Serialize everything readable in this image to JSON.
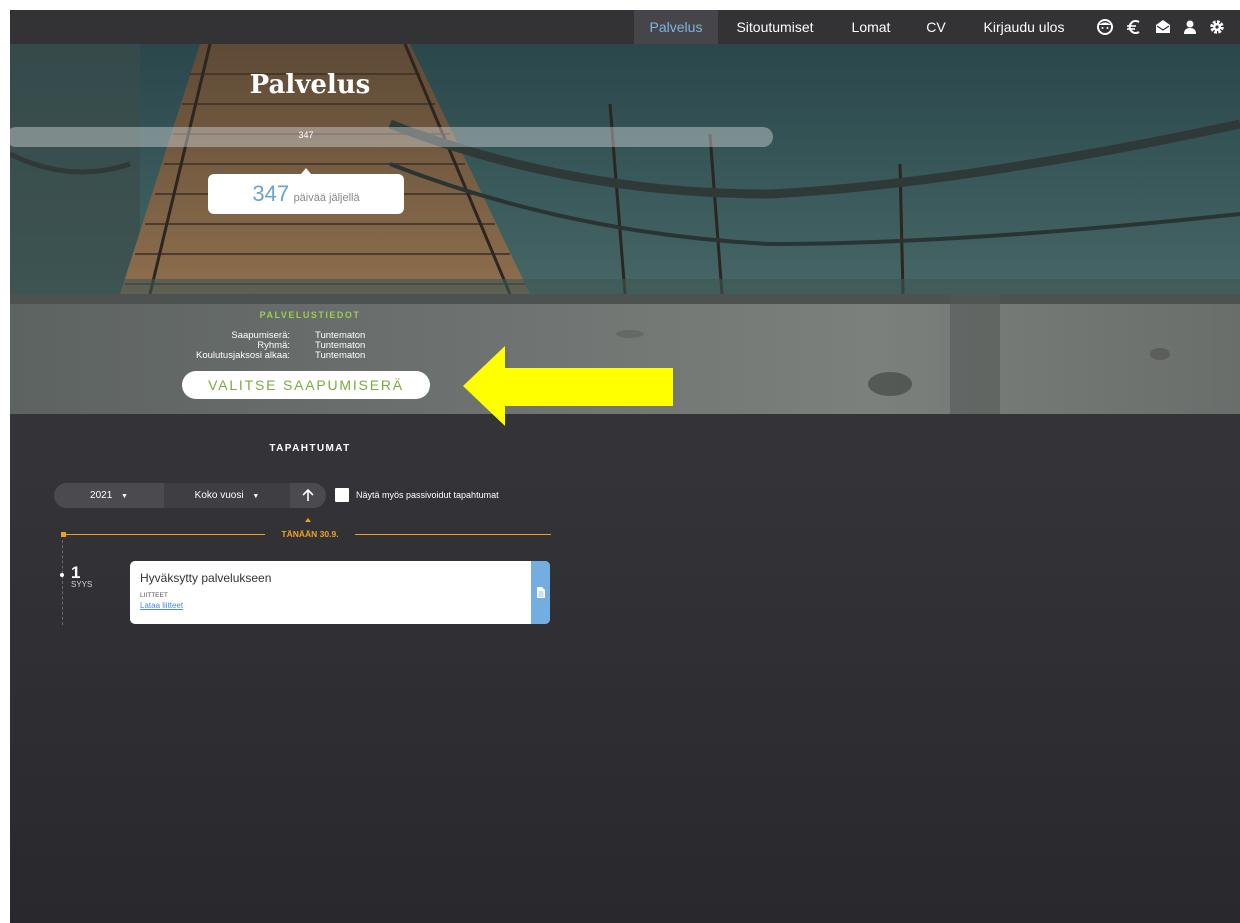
{
  "nav": {
    "items": [
      {
        "label": "Palvelus",
        "active": true
      },
      {
        "label": "Sitoutumiset",
        "active": false
      },
      {
        "label": "Lomat",
        "active": false
      },
      {
        "label": "CV",
        "active": false
      },
      {
        "label": "Kirjaudu ulos",
        "active": false
      }
    ],
    "icons": [
      "face-icon",
      "euro-icon",
      "mail-icon",
      "user-icon",
      "gear-icon"
    ],
    "active_color": "#7fb3dd"
  },
  "hero": {
    "title": "Palvelus",
    "progress_label": "347",
    "progress_fraction": 0.0,
    "days_remaining": "347",
    "days_text": "päivää jäljellä"
  },
  "info": {
    "heading": "PALVELUSTIEDOT",
    "rows": [
      {
        "label": "Saapumiserä:",
        "value": "Tuntematon"
      },
      {
        "label": "Ryhmä:",
        "value": "Tuntematon"
      },
      {
        "label": "Koulutusjaksosi alkaa:",
        "value": "Tuntematon"
      }
    ],
    "button_label": "VALITSE SAAPUMISERÄ",
    "accent_color": "#9dcc4e"
  },
  "events": {
    "heading": "TAPAHTUMAT",
    "year": "2021",
    "period": "Koko vuosi",
    "passive_label": "Näytä myös passivoidut tapahtumat",
    "passive_checked": false,
    "today_label": "TÄNÄÄN 30.9.",
    "today_color": "#f0a020",
    "items": [
      {
        "day": "1",
        "month": "SYYS",
        "title": "Hyväksytty palvelukseen",
        "attachments_label": "LIITTEET",
        "attachments_link": "Lataa liitteet"
      }
    ]
  }
}
